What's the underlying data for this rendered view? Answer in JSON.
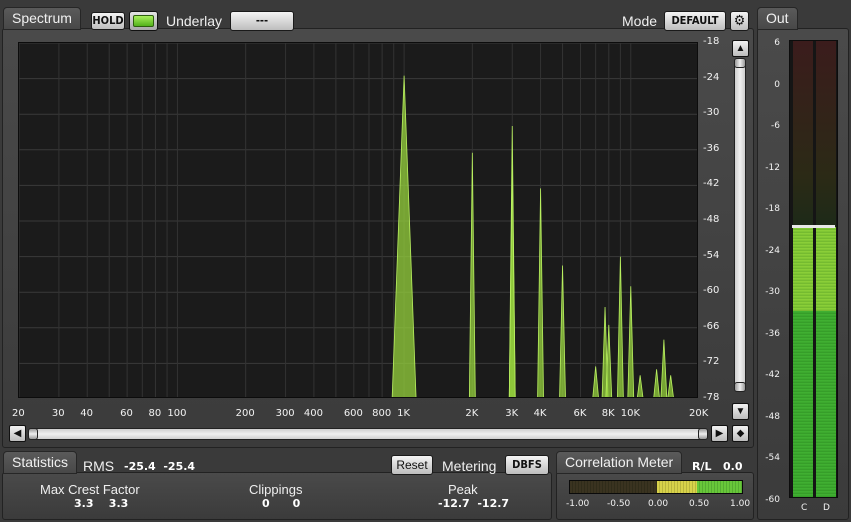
{
  "spectrum": {
    "tab_label": "Spectrum",
    "hold_label": "HOLD",
    "hold_active": true,
    "underlay_label": "Underlay",
    "underlay_value": "---",
    "mode_label": "Mode",
    "mode_value": "DEFAULT",
    "y_ticks": [
      "-18",
      "-24",
      "-30",
      "-36",
      "-42",
      "-48",
      "-54",
      "-60",
      "-66",
      "-72",
      "-78"
    ],
    "x_ticks": [
      "20",
      "30",
      "40",
      "60",
      "80",
      "100",
      "200",
      "300",
      "400",
      "600",
      "800",
      "1K",
      "2K",
      "3K",
      "4K",
      "6K",
      "8K",
      "10K",
      "20K"
    ]
  },
  "out": {
    "tab_label": "Out",
    "scale": [
      "6",
      "0",
      "-6",
      "-12",
      "-18",
      "-24",
      "-30",
      "-36",
      "-42",
      "-48",
      "-54",
      "-60"
    ],
    "channel_labels": [
      "C",
      "D"
    ]
  },
  "statistics": {
    "tab_label": "Statistics",
    "rms_label": "RMS",
    "rms_values": "-25.4  -25.4",
    "reset_label": "Reset",
    "metering_label": "Metering",
    "metering_value": "DBFS",
    "max_crest_label": "Max Crest Factor",
    "max_crest_values": "3.3    3.3",
    "clippings_label": "Clippings",
    "clippings_values": "0      0",
    "peak_label": "Peak",
    "peak_values": "-12.7  -12.7"
  },
  "correlation": {
    "tab_label": "Correlation Meter",
    "rl_label": "R/L",
    "rl_value": "0.0",
    "scale": [
      "-1.00",
      "-0.50",
      "0.00",
      "0.50",
      "1.00"
    ]
  },
  "chart_data": {
    "type": "line",
    "title": "",
    "xlabel": "",
    "ylabel": "",
    "x_scale": "log",
    "xlim": [
      20,
      20000
    ],
    "ylim": [
      -78,
      -18
    ],
    "series": [
      {
        "values": [
          {
            "x": 1000,
            "y": -23.5
          },
          {
            "x": 2000,
            "y": -36.5
          },
          {
            "x": 3000,
            "y": -32
          },
          {
            "x": 3000,
            "y": -38.5
          },
          {
            "x": 4000,
            "y": -42.5
          },
          {
            "x": 5000,
            "y": -55.5
          },
          {
            "x": 7000,
            "y": -72.5
          },
          {
            "x": 7700,
            "y": -62.5
          },
          {
            "x": 8000,
            "y": -65.5
          },
          {
            "x": 9000,
            "y": -54
          },
          {
            "x": 10000,
            "y": -59
          },
          {
            "x": 11000,
            "y": -74
          },
          {
            "x": 13000,
            "y": -73
          },
          {
            "x": 14000,
            "y": -68
          },
          {
            "x": 15000,
            "y": -74
          }
        ]
      }
    ],
    "grid": true
  }
}
